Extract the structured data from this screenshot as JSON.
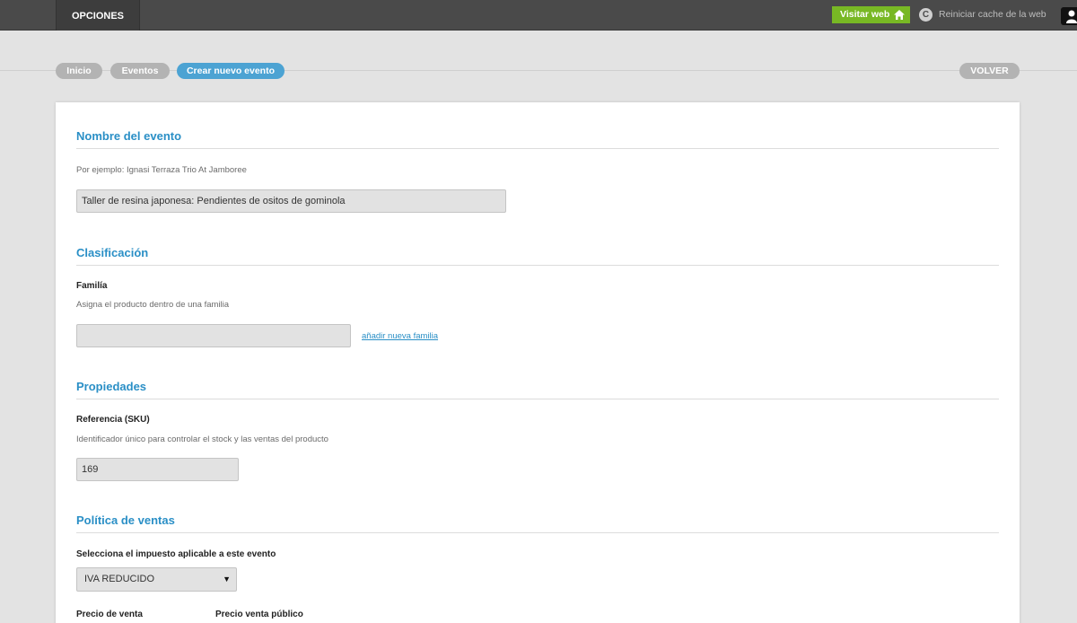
{
  "topbar": {
    "tab_label": "OPCIONES",
    "visit_label": "Visitar web",
    "cache_icon_glyph": "C",
    "cache_label": "Reiniciar cache de la web"
  },
  "breadcrumb": {
    "items": [
      "Inicio",
      "Eventos",
      "Crear nuevo evento"
    ],
    "back_label": "VOLVER"
  },
  "form": {
    "name_section": {
      "title": "Nombre del evento",
      "hint": "Por ejemplo: Ignasi Terraza Trio At Jamboree",
      "value": "Taller de resina japonesa: Pendientes de ositos de gominola"
    },
    "classification_section": {
      "title": "Clasificación",
      "family_label": "Familía",
      "family_hint": "Asigna el producto dentro de una familia",
      "family_value": "",
      "add_family_link": "añadir nueva familia"
    },
    "properties_section": {
      "title": "Propiedades",
      "sku_label": "Referencia (SKU)",
      "sku_hint": "Identificador único para controlar el stock y las ventas del producto",
      "sku_value": "169"
    },
    "sales_section": {
      "title": "Política de ventas",
      "tax_label": "Selecciona el impuesto aplicable a este evento",
      "tax_value": "IVA REDUCIDO",
      "price_label": "Precio de venta",
      "public_price_label": "Precio venta público"
    }
  },
  "colors": {
    "accent": "#2a8fc6",
    "active_pill": "#4ca3d3",
    "visit_button": "#78b824",
    "topbar": "#4a4a4a"
  },
  "icons": [
    "home-icon",
    "refresh-icon",
    "user-icon",
    "chevron-down-icon"
  ]
}
